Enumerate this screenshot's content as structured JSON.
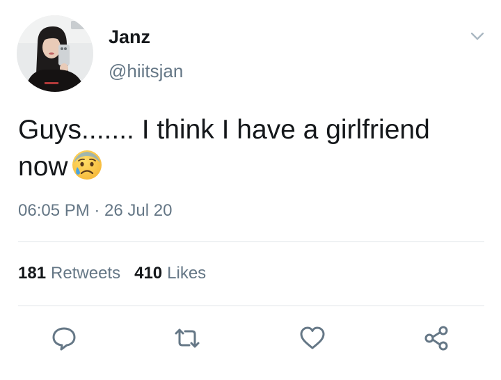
{
  "tweet": {
    "author": {
      "display_name": "Janz",
      "handle": "@hiitsjan"
    },
    "text_line1": "Guys....... I think I have a girlfriend",
    "text_line2": "now",
    "emoji": "anxious-face-with-sweat-emoji",
    "timestamp": "06:05 PM · 26 Jul 20",
    "stats": {
      "retweets_count": "181",
      "retweets_label": "Retweets",
      "likes_count": "410",
      "likes_label": "Likes"
    }
  },
  "icons": {
    "menu": "chevron-down-icon",
    "reply": "speech-bubble-icon",
    "retweet": "retweet-arrows-icon",
    "like": "heart-icon",
    "share": "share-nodes-icon"
  },
  "colors": {
    "text_primary": "#14171a",
    "text_secondary": "#657786",
    "divider": "#dfe4e8",
    "icon": "#657786"
  }
}
